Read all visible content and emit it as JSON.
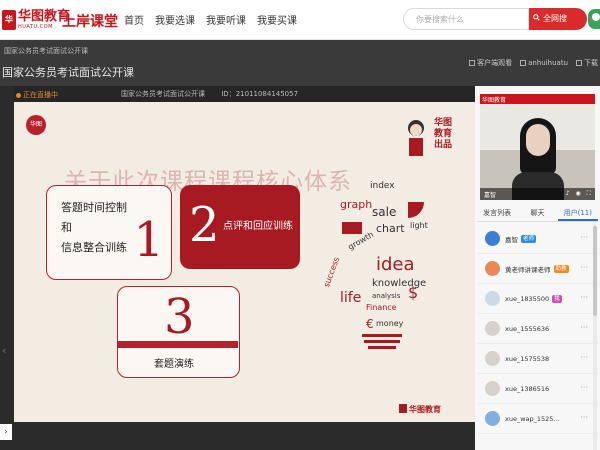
{
  "topnav": {
    "logo_cn": "华图教育",
    "logo_en": "HUATU.COM",
    "brand_sub": "上岸课堂",
    "links": [
      "首页",
      "我要选课",
      "我要听课",
      "我要买课"
    ],
    "search_placeholder": "你要搜索什么",
    "search_button": "全网搜"
  },
  "course": {
    "breadcrumb": "国家公务员考试面试公开课",
    "title": "国家公务员考试面试公开课",
    "actions": [
      "客户端观看",
      "anhuihuatu",
      "下载"
    ]
  },
  "player": {
    "status": "正在直播中",
    "room_name": "国家公务员考试面试公开课",
    "room_id": "ID：21011084145057",
    "play_icon": "play-icon"
  },
  "slide": {
    "badge": "华图",
    "heading": "关于此次课程课程核心体系",
    "mascot_text": "华图\n教育\n出品",
    "cards": [
      {
        "label": "答题时间控制\n和\n信息整合训练",
        "num": "1"
      },
      {
        "label": "点评和回应训练",
        "num": "2"
      },
      {
        "label": "套题演练",
        "num": "3"
      }
    ],
    "bulb_words": [
      "index",
      "graph",
      "sale",
      "chart",
      "light",
      "idea",
      "knowledge",
      "life",
      "analysis",
      "Finance",
      "money",
      "success",
      "growth"
    ],
    "footer_logo": "华图教育"
  },
  "right": {
    "video_logo": "华图教育",
    "video_user": "嘉智",
    "tabs": [
      "发言列表",
      "聊天",
      "用户(11)"
    ],
    "active_tab": 2,
    "users": [
      {
        "name": "嘉智",
        "tag": "老师",
        "tag_color": "#2f8ee0",
        "avatar": "#3b7dd8"
      },
      {
        "name": "黄老师讲课老师",
        "tag": "助教",
        "tag_color": "#f08a24",
        "avatar": "#e88a55"
      },
      {
        "name": "xue_1835500",
        "tag": "我",
        "tag_color": "#d24fb7",
        "avatar": "#c9dbe6"
      },
      {
        "name": "xue_1555636",
        "tag": "",
        "tag_color": "",
        "avatar": "#d7d2cb"
      },
      {
        "name": "xue_1575538",
        "tag": "",
        "tag_color": "",
        "avatar": "#d7d2cb"
      },
      {
        "name": "xue_1386516",
        "tag": "",
        "tag_color": "",
        "avatar": "#d7d2cb"
      },
      {
        "name": "xue_wap_1525...",
        "tag": "",
        "tag_color": "",
        "avatar": "#7fb0e0"
      }
    ]
  },
  "colors": {
    "brand_red": "#c8161d",
    "accent_blue": "#2f6bd1"
  }
}
